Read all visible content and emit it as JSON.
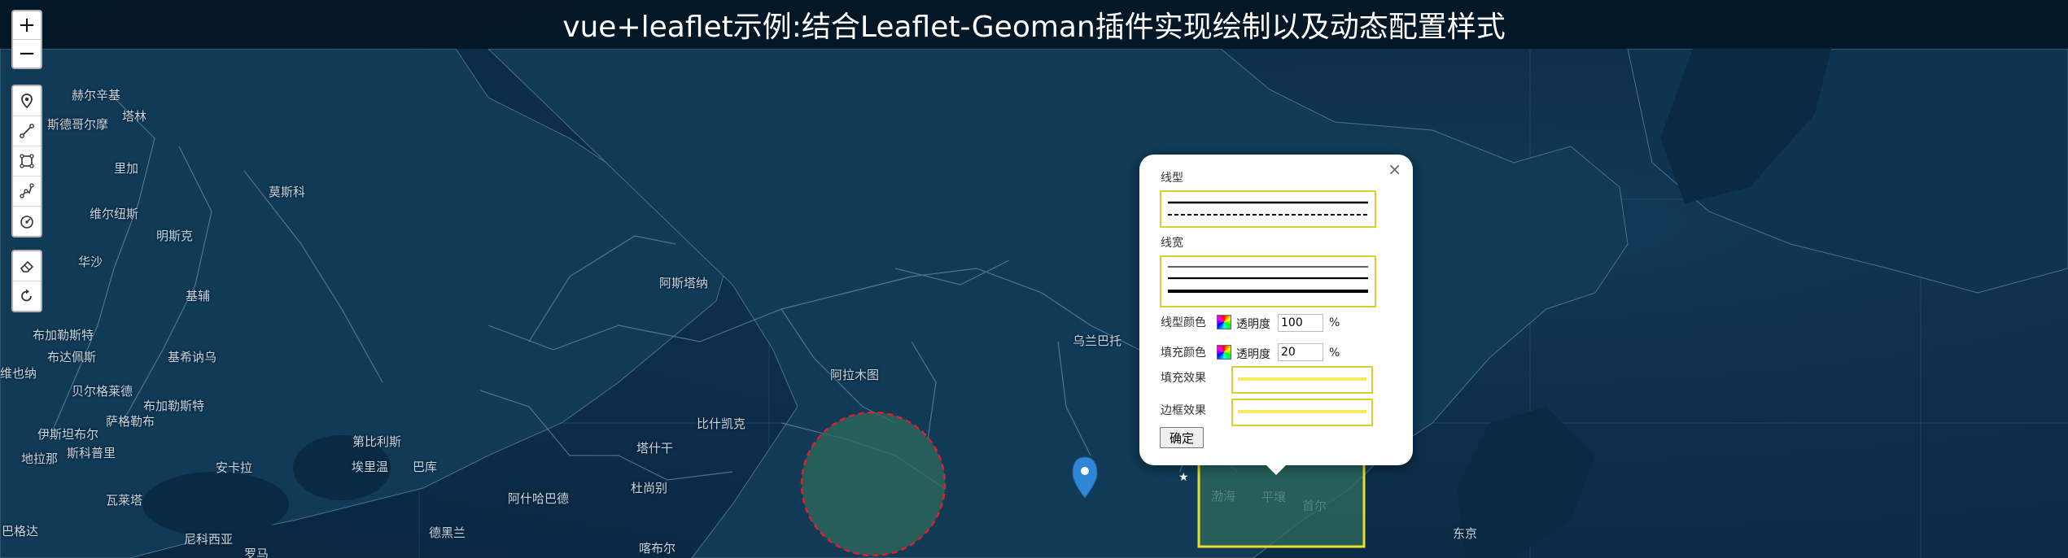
{
  "header": {
    "title": "vue+leaflet示例:结合Leaflet-Geoman插件实现绘制以及动态配置样式"
  },
  "zoom": {
    "in_label": "+",
    "out_label": "−"
  },
  "draw_tools": [
    "marker-icon",
    "polyline-icon",
    "rectangle-icon",
    "polygon-icon",
    "circle-icon"
  ],
  "edit_tools": [
    "eraser-icon",
    "rotate-icon"
  ],
  "map_labels": [
    "赫尔辛基",
    "塔林",
    "斯德哥尔摩",
    "里加",
    "莫斯科",
    "维尔纽斯",
    "明斯克",
    "华沙",
    "基辅",
    "布加勒斯特",
    "布达佩斯",
    "维也纳",
    "基希讷乌",
    "贝尔格莱德",
    "布加勒斯特",
    "伊斯坦布尔",
    "安卡拉",
    "地拉那",
    "斯科普里",
    "萨格勒布",
    "第比利斯",
    "埃里温",
    "巴库",
    "德黑兰",
    "阿什哈巴德",
    "杜尚别",
    "塔什干",
    "比什凯克",
    "阿斯塔纳",
    "乌兰巴托",
    "平壤",
    "首尔",
    "渤海",
    "东京",
    "阿拉木图",
    "喀布尔",
    "巴格达",
    "尼科西亚",
    "瓦莱塔",
    "罗马"
  ],
  "popup": {
    "close_label": "×",
    "line_type_label": "线型",
    "line_width_label": "线宽",
    "line_color_label": "线型颜色",
    "line_opacity_label": "透明度",
    "line_opacity_value": "100",
    "fill_color_label": "填充颜色",
    "fill_opacity_label": "透明度",
    "fill_opacity_value": "20",
    "percent": "%",
    "fill_effect_label": "填充效果",
    "border_effect_label": "边框效果",
    "confirm_label": "确定"
  },
  "colors": {
    "accent_yellow": "#e8df2a",
    "circle_stroke": "#e11d2b",
    "circle_fill": "#2f6b5c",
    "marker": "#2f86d6"
  }
}
